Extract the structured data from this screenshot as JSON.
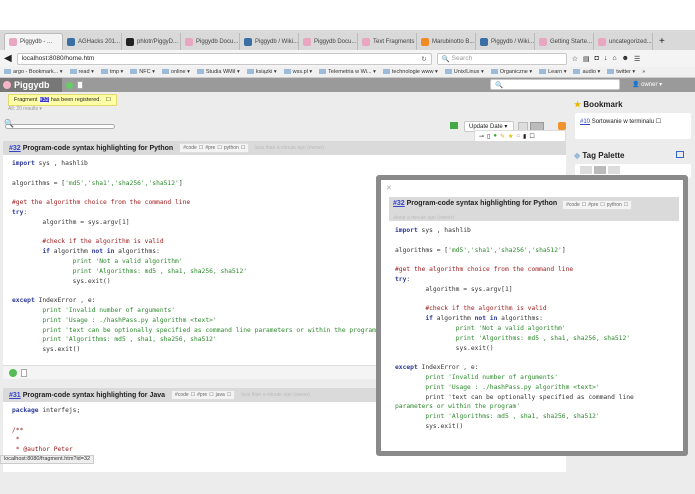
{
  "browser": {
    "tabs": [
      {
        "label": "Piggydb - ...",
        "color": "#e9a6c0",
        "active": true
      },
      {
        "label": "AGHacks 201...",
        "color": "#3a6ea5"
      },
      {
        "label": "phlotr/PiggyD...",
        "color": "#222"
      },
      {
        "label": "Piggydb Docu...",
        "color": "#e9a6c0"
      },
      {
        "label": "Piggydb / Wiki...",
        "color": "#3a6ea5"
      },
      {
        "label": "Piggydb Docu...",
        "color": "#e9a6c0"
      },
      {
        "label": "Text Fragments",
        "color": "#e9a6c0"
      },
      {
        "label": "Marubinotto B...",
        "color": "#f08a24"
      },
      {
        "label": "Piggydb / Wiki...",
        "color": "#3a6ea5"
      },
      {
        "label": "Getting Starte...",
        "color": "#e9a6c0"
      },
      {
        "label": "uncategorized...",
        "color": "#e9a6c0"
      }
    ],
    "new_tab": "+",
    "url": "localhost:8080/home.htm",
    "search_placeholder": "Search",
    "bookmarks": [
      "argo - Bookmark... ▾",
      "read ▾",
      "tmp ▾",
      "NFC ▾",
      "online ▾",
      "Studia WMiI ▾",
      "ksiązki ▾",
      "wss.pl ▾",
      "Telemetria w Wi... ▾",
      "technologie www ▾",
      "Unix/Linux ▾",
      "Organiczne ▾",
      "Learn ▾",
      "audio ▾",
      "twitter ▾"
    ],
    "more": "»",
    "status_url": "localhost:8080/fragment.htm?id=32"
  },
  "app": {
    "name": "Piggydb",
    "user": "owner",
    "notice": {
      "pre": "Fragment",
      "id": "#32",
      "post": "has been registered."
    },
    "filter": "All: 20 results",
    "sort": "Update Date",
    "bookmark_title": "Bookmark",
    "bookmark_item": {
      "id": "#10",
      "label": "Sortowanie w terminalu"
    },
    "tag_palette": "Tag Palette"
  },
  "fragments": [
    {
      "id": "#32",
      "title": "Program-code syntax highlighting for Python",
      "tags": [
        "#code",
        "#pre",
        "python"
      ],
      "meta": "less than a minute ago (owner)"
    },
    {
      "id": "#31",
      "title": "Program-code syntax highlighting for Java",
      "tags": [
        "#code",
        "#pre",
        "java"
      ],
      "meta": "less than a minute ago (owner)"
    }
  ],
  "popup": {
    "close": "✕",
    "id": "#32",
    "title": "Program-code syntax highlighting for Python",
    "tags": [
      "#code",
      "#pre",
      "python"
    ],
    "meta": "about a minute ago (owner)"
  },
  "python_code": [
    [
      [
        "import",
        "kw"
      ],
      [
        " sys , hashlib",
        ""
      ]
    ],
    [],
    [
      [
        "algorithms = [",
        ""
      ],
      [
        "'md5','sha1','sha256','sha512'",
        "str"
      ],
      [
        "]",
        ""
      ]
    ],
    [],
    [
      [
        "#get the algorithm choice from the command line",
        "com"
      ]
    ],
    [
      [
        "try",
        "kw"
      ],
      [
        ":",
        ""
      ]
    ],
    [
      [
        "        algorithm = sys.argv[1]",
        ""
      ]
    ],
    [],
    [
      [
        "        #check if the algorithm is valid",
        "com"
      ]
    ],
    [
      [
        "        ",
        ""
      ],
      [
        "if",
        "kw"
      ],
      [
        " algorithm ",
        ""
      ],
      [
        "not in",
        "kw"
      ],
      [
        " algorithms:",
        ""
      ]
    ],
    [
      [
        "                print 'Not a valid algorithm'",
        "pr"
      ]
    ],
    [
      [
        "                print 'Algorithms: md5 , sha1, sha256, sha512'",
        "pr"
      ]
    ],
    [
      [
        "                sys.exit()",
        ""
      ]
    ],
    [],
    [
      [
        "except",
        "kw"
      ],
      [
        " IndexError , e:",
        ""
      ]
    ],
    [
      [
        "        print 'Invalid number of arguments'",
        "pr"
      ]
    ],
    [
      [
        "        print 'Usage : ./hashPass.py algorithm <text>'",
        "pr"
      ]
    ],
    [
      [
        "        print 'text can be optionally specified as command line parameters or within the program'",
        "pr"
      ]
    ],
    [
      [
        "        print 'Algorithms: md5 , sha1, sha256, sha512'",
        "pr"
      ]
    ],
    [
      [
        "        sys.exit()",
        ""
      ]
    ]
  ],
  "popup_code": [
    [
      [
        "import",
        "kw"
      ],
      [
        " sys , hashlib",
        ""
      ]
    ],
    [],
    [
      [
        "algorithms = [",
        ""
      ],
      [
        "'md5','sha1','sha256','sha512'",
        "str"
      ],
      [
        "]",
        ""
      ]
    ],
    [],
    [
      [
        "#get the algorithm choice from the command line",
        "com"
      ]
    ],
    [
      [
        "try",
        "kw"
      ],
      [
        ":",
        ""
      ]
    ],
    [
      [
        "        algorithm = sys.argv[1]",
        ""
      ]
    ],
    [],
    [
      [
        "        #check if the algorithm is valid",
        "com"
      ]
    ],
    [
      [
        "        ",
        ""
      ],
      [
        "if",
        "kw"
      ],
      [
        " algorithm ",
        ""
      ],
      [
        "not in",
        "kw"
      ],
      [
        " algorithms:",
        ""
      ]
    ],
    [
      [
        "                print 'Not a valid algorithm'",
        "pr"
      ]
    ],
    [
      [
        "                print 'Algorithms: md5 , sha1, sha256, sha512'",
        "pr"
      ]
    ],
    [
      [
        "                sys.exit()",
        ""
      ]
    ],
    [],
    [
      [
        "except",
        "kw"
      ],
      [
        " IndexError , e:",
        ""
      ]
    ],
    [
      [
        "        print 'Invalid number of arguments'",
        "pr"
      ]
    ],
    [
      [
        "        print 'Usage : ./hashPass.py algorithm <text>'",
        "pr"
      ]
    ],
    [
      [
        "        print 'text can be optionally specified as command line",
        ""
      ]
    ],
    [
      [
        "parameters or within the program'",
        "pr"
      ]
    ],
    [
      [
        "        print 'Algorithms: md5 , sha1, sha256, sha512'",
        "pr"
      ]
    ],
    [
      [
        "        sys.exit()",
        ""
      ]
    ]
  ],
  "java_code": [
    [
      [
        "package",
        "kw"
      ],
      [
        " interfejs;",
        ""
      ]
    ],
    [],
    [
      [
        "/**",
        "com"
      ]
    ],
    [
      [
        " *",
        "com"
      ]
    ],
    [
      [
        " * @author Peter",
        "com"
      ]
    ]
  ]
}
